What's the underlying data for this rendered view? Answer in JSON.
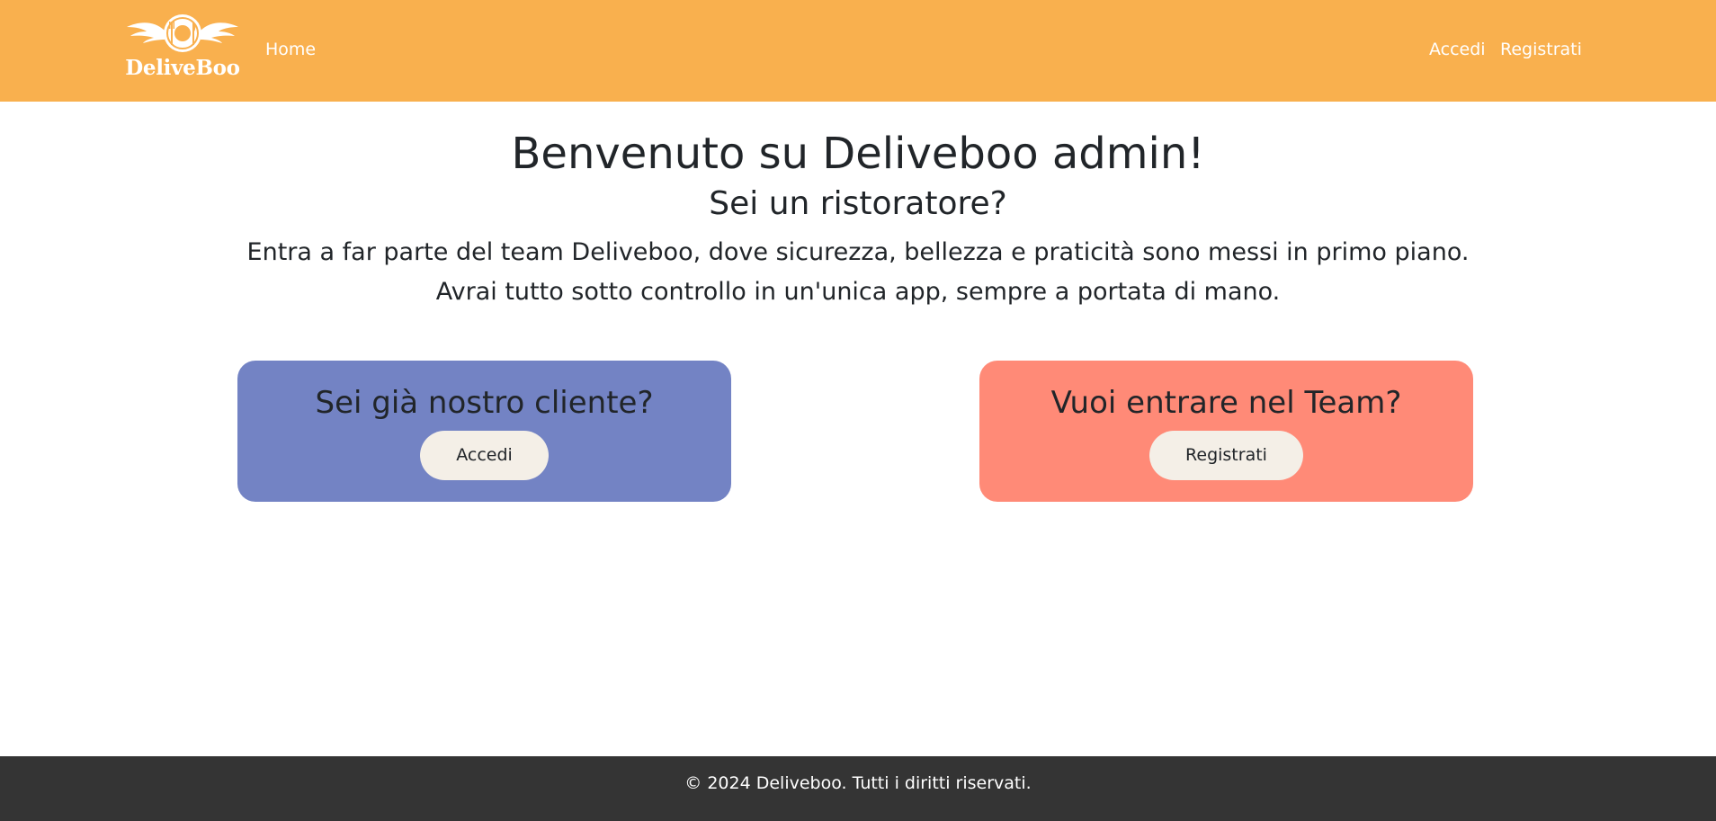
{
  "colors": {
    "navbar_bg": "#f9b04e",
    "client_card_bg": "#7383c4",
    "team_card_bg": "#ff8a77",
    "button_bg": "#f4efe7",
    "footer_bg": "#343434"
  },
  "navbar": {
    "logo_icon": "winged-plate-icon",
    "logo_text": "DeliveBoo",
    "home_label": "Home",
    "login_label": "Accedi",
    "register_label": "Registrati"
  },
  "hero": {
    "title": "Benvenuto su Deliveboo admin!",
    "subtitle": "Sei un ristoratore?",
    "text": "Entra a far parte del team Deliveboo, dove sicurezza, bellezza e praticità sono messi in primo piano. Avrai tutto sotto controllo in un'unica app, sempre a portata di mano."
  },
  "cards": {
    "client": {
      "title": "Sei già nostro cliente?",
      "button_label": "Accedi"
    },
    "team": {
      "title": "Vuoi entrare nel Team?",
      "button_label": "Registrati"
    }
  },
  "footer": {
    "copyright": "© 2024 Deliveboo. Tutti i diritti riservati."
  }
}
